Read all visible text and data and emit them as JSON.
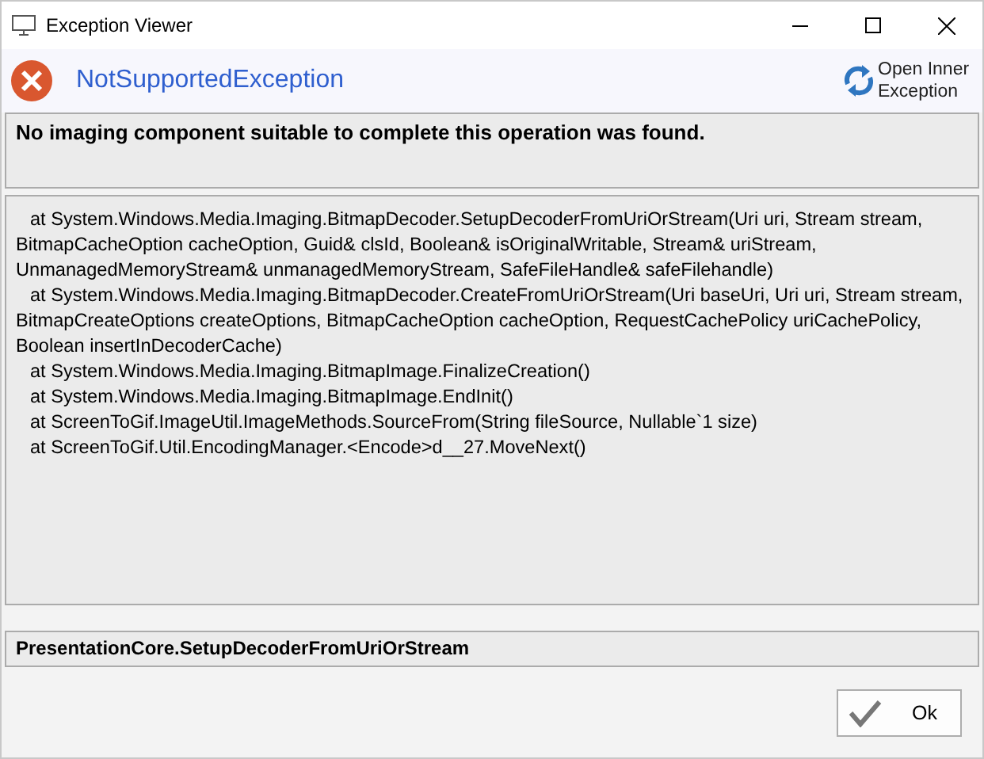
{
  "window": {
    "title": "Exception Viewer"
  },
  "header": {
    "exception_type": "NotSupportedException",
    "inner_button": "Open Inner Exception"
  },
  "message": "No imaging component suitable to complete this operation was found.",
  "stack_trace": [
    "at System.Windows.Media.Imaging.BitmapDecoder.SetupDecoderFromUriOrStream(Uri uri, Stream stream, BitmapCacheOption cacheOption, Guid& clsId, Boolean& isOriginalWritable, Stream& uriStream, UnmanagedMemoryStream& unmanagedMemoryStream, SafeFileHandle& safeFilehandle)",
    "at System.Windows.Media.Imaging.BitmapDecoder.CreateFromUriOrStream(Uri baseUri, Uri uri, Stream stream, BitmapCreateOptions createOptions, BitmapCacheOption cacheOption, RequestCachePolicy uriCachePolicy, Boolean insertInDecoderCache)",
    "at System.Windows.Media.Imaging.BitmapImage.FinalizeCreation()",
    "at System.Windows.Media.Imaging.BitmapImage.EndInit()",
    "at ScreenToGif.ImageUtil.ImageMethods.SourceFrom(String fileSource, Nullable`1 size)",
    "at ScreenToGif.Util.EncodingManager.<Encode>d__27.MoveNext()"
  ],
  "source": "PresentationCore.SetupDecoderFromUriOrStream",
  "buttons": [
    "Ok"
  ]
}
